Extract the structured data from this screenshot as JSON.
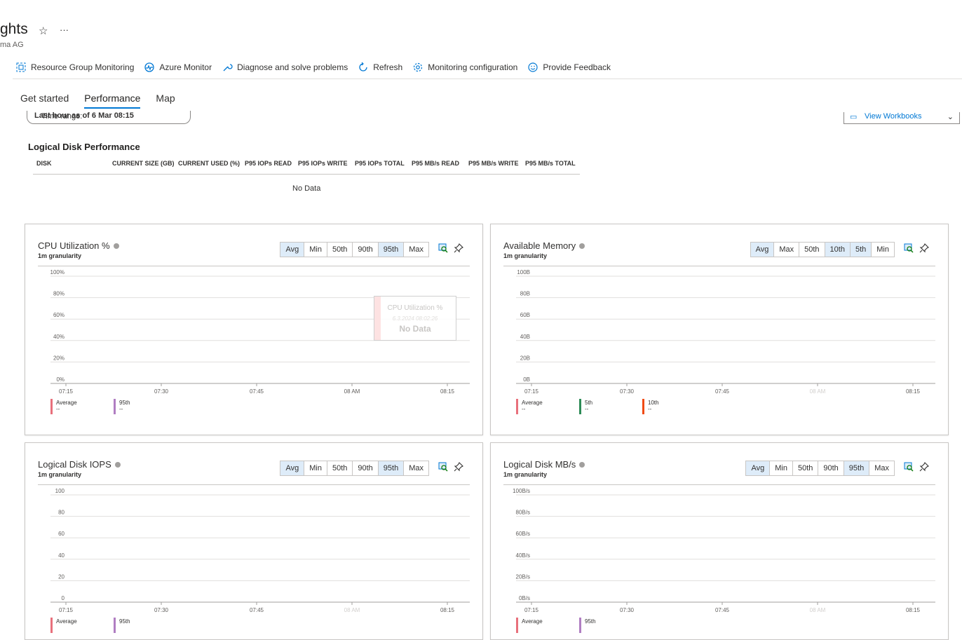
{
  "header": {
    "title": "ghts",
    "subtitle": "ma AG"
  },
  "toolbar": [
    {
      "label": "Resource Group Monitoring",
      "icon": "resource-group-icon"
    },
    {
      "label": "Azure Monitor",
      "icon": "azure-monitor-icon"
    },
    {
      "label": "Diagnose and solve problems",
      "icon": "wrench-icon"
    },
    {
      "label": "Refresh",
      "icon": "refresh-icon"
    },
    {
      "label": "Monitoring configuration",
      "icon": "gear-icon"
    },
    {
      "label": "Provide Feedback",
      "icon": "smiley-icon"
    }
  ],
  "tabs": [
    {
      "label": "Get started",
      "active": false
    },
    {
      "label": "Performance",
      "active": true
    },
    {
      "label": "Map",
      "active": false
    }
  ],
  "timerange": {
    "label": "Time range: ",
    "value": "Last hour as of 6 Mar 08:15"
  },
  "view_workbooks": "View Workbooks",
  "disk_table": {
    "title": "Logical Disk Performance",
    "columns": [
      "DISK",
      "CURRENT SIZE (GB)",
      "CURRENT USED (%)",
      "P95 IOPs READ",
      "P95 IOPs WRITE",
      "P95 IOPs TOTAL",
      "P95 MB/s READ",
      "P95 MB/s WRITE",
      "P95 MB/s TOTAL"
    ],
    "empty": "No Data"
  },
  "x_ticks": [
    "07:15",
    "07:30",
    "07:45",
    "08 AM",
    "08:15"
  ],
  "cards": [
    {
      "id": "cpu",
      "title": "CPU Utilization %",
      "granularity": "1m granularity",
      "buttons": [
        {
          "l": "Avg",
          "s": true
        },
        {
          "l": "Min",
          "s": false
        },
        {
          "l": "50th",
          "s": false
        },
        {
          "l": "90th",
          "s": false
        },
        {
          "l": "95th",
          "s": true
        },
        {
          "l": "Max",
          "s": false
        }
      ],
      "y_ticks": [
        "100%",
        "80%",
        "60%",
        "40%",
        "20%",
        "0%"
      ],
      "legend": [
        {
          "label": "Average",
          "value": "--",
          "color": "#e8707c"
        },
        {
          "label": "95th",
          "value": "--",
          "color": "#b07ec2"
        }
      ],
      "overlay": {
        "title": "CPU Utilization %",
        "date": "6.3.2024 08:02:26",
        "msg": "No Data"
      }
    },
    {
      "id": "mem",
      "title": "Available Memory",
      "granularity": "1m granularity",
      "buttons": [
        {
          "l": "Avg",
          "s": true
        },
        {
          "l": "Max",
          "s": false
        },
        {
          "l": "50th",
          "s": false
        },
        {
          "l": "10th",
          "s": true
        },
        {
          "l": "5th",
          "s": true
        },
        {
          "l": "Min",
          "s": false
        }
      ],
      "y_ticks": [
        "100B",
        "80B",
        "60B",
        "40B",
        "20B",
        "0B"
      ],
      "legend": [
        {
          "label": "Average",
          "value": "--",
          "color": "#e8707c"
        },
        {
          "label": "5th",
          "value": "--",
          "color": "#2e8b57"
        },
        {
          "label": "10th",
          "value": "--",
          "color": "#f04b14"
        }
      ]
    },
    {
      "id": "iops",
      "title": "Logical Disk IOPS",
      "granularity": "1m granularity",
      "buttons": [
        {
          "l": "Avg",
          "s": true
        },
        {
          "l": "Min",
          "s": false
        },
        {
          "l": "50th",
          "s": false
        },
        {
          "l": "90th",
          "s": false
        },
        {
          "l": "95th",
          "s": true
        },
        {
          "l": "Max",
          "s": false
        }
      ],
      "y_ticks": [
        "100",
        "80",
        "60",
        "40",
        "20",
        "0"
      ],
      "legend": [
        {
          "label": "Average",
          "value": "",
          "color": "#e8707c"
        },
        {
          "label": "95th",
          "value": "",
          "color": "#b07ec2"
        }
      ]
    },
    {
      "id": "mbs",
      "title": "Logical Disk MB/s",
      "granularity": "1m granularity",
      "buttons": [
        {
          "l": "Avg",
          "s": true
        },
        {
          "l": "Min",
          "s": false
        },
        {
          "l": "50th",
          "s": false
        },
        {
          "l": "90th",
          "s": false
        },
        {
          "l": "95th",
          "s": true
        },
        {
          "l": "Max",
          "s": false
        }
      ],
      "y_ticks": [
        "100B/s",
        "80B/s",
        "60B/s",
        "40B/s",
        "20B/s",
        "0B/s"
      ],
      "legend": [
        {
          "label": "Average",
          "value": "",
          "color": "#e8707c"
        },
        {
          "label": "95th",
          "value": "",
          "color": "#b07ec2"
        }
      ]
    }
  ]
}
